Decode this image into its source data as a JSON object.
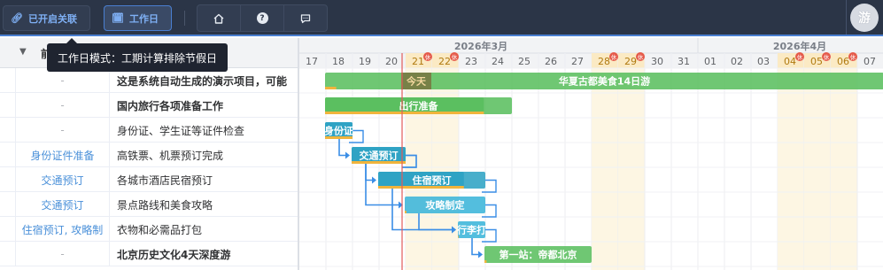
{
  "toolbar": {
    "linked_label": "已开启关联",
    "link_icon": "link-icon",
    "workday_label": "工作日",
    "calendar_icon": "calendar-icon",
    "home_icon": "home-icon",
    "help_glyph": "?",
    "comment_icon": "comment-icon",
    "avatar_text": "游"
  },
  "tooltip": {
    "text": "工作日模式：工期计算排除节假日"
  },
  "grid": {
    "header_text": "前",
    "rows": [
      {
        "dep": "-",
        "name": "这是系统自动生成的演示项目，可能",
        "bold": true
      },
      {
        "dep": "-",
        "name": "国内旅行各项准备工作",
        "bold": true
      },
      {
        "dep": "-",
        "name": "身份证、学生证等证件检查",
        "bold": false
      },
      {
        "dep": "身份证件准备",
        "name": "高铁票、机票预订完成",
        "bold": false
      },
      {
        "dep": "交通预订",
        "name": "各城市酒店民宿预订",
        "bold": false
      },
      {
        "dep": "交通预订",
        "name": "景点路线和美食攻略",
        "bold": false
      },
      {
        "dep": "住宿预订, 攻略制",
        "name": "衣物和必需品打包",
        "bold": false
      },
      {
        "dep": "-",
        "name": "北京历史文化4天深度游",
        "bold": true
      }
    ]
  },
  "timeline": {
    "months": [
      {
        "label": "2026年3月",
        "day_index": 7
      },
      {
        "label": "2026年4月",
        "day_index": 19
      }
    ],
    "days": [
      {
        "d": "17",
        "hl": false,
        "holiday": false
      },
      {
        "d": "18",
        "hl": false,
        "holiday": false
      },
      {
        "d": "19",
        "hl": false,
        "holiday": false
      },
      {
        "d": "20",
        "hl": false,
        "holiday": false
      },
      {
        "d": "21",
        "hl": true,
        "holiday": true
      },
      {
        "d": "22",
        "hl": true,
        "holiday": true
      },
      {
        "d": "23",
        "hl": false,
        "holiday": false
      },
      {
        "d": "24",
        "hl": false,
        "holiday": false
      },
      {
        "d": "25",
        "hl": false,
        "holiday": false
      },
      {
        "d": "26",
        "hl": false,
        "holiday": false
      },
      {
        "d": "27",
        "hl": false,
        "holiday": false
      },
      {
        "d": "28",
        "hl": true,
        "holiday": true
      },
      {
        "d": "29",
        "hl": true,
        "holiday": true
      },
      {
        "d": "30",
        "hl": false,
        "holiday": false
      },
      {
        "d": "31",
        "hl": false,
        "holiday": false
      },
      {
        "d": "01",
        "hl": false,
        "holiday": false
      },
      {
        "d": "02",
        "hl": false,
        "holiday": false
      },
      {
        "d": "03",
        "hl": false,
        "holiday": false
      },
      {
        "d": "04",
        "hl": true,
        "holiday": true
      },
      {
        "d": "05",
        "hl": true,
        "holiday": true
      },
      {
        "d": "06",
        "hl": true,
        "holiday": true
      },
      {
        "d": "07",
        "hl": false,
        "holiday": false
      }
    ],
    "holiday_mark": "休",
    "today_label": "今天",
    "today_index": 4,
    "bars": [
      {
        "row": 0,
        "start": 0,
        "end": 21,
        "label": "华夏古都美食14日游",
        "color": "#5bbf60",
        "text_color": "#ffffff",
        "progress": 0
      },
      {
        "row": 1,
        "start": 0,
        "end": 7,
        "label": "出行准备",
        "color": "#5bbf60",
        "text_color": "#ffffff",
        "progress": 0.85
      },
      {
        "row": 2,
        "start": 0,
        "end": 1,
        "label": "身份证",
        "color": "#2fa3c4",
        "text_color": "#ffffff",
        "progress": 1
      },
      {
        "row": 3,
        "start": 1,
        "end": 3,
        "label": "交通预订",
        "color": "#2fa3c4",
        "text_color": "#ffffff",
        "progress": 1
      },
      {
        "row": 4,
        "start": 2,
        "end": 6,
        "label": "住宿预订",
        "color": "#2fa3c4",
        "text_color": "#ffffff",
        "progress": 0.8
      },
      {
        "row": 5,
        "start": 3,
        "end": 6,
        "label": "攻略制定",
        "color": "#3bb5d9",
        "text_color": "#ffffff",
        "progress": 0
      },
      {
        "row": 6,
        "start": 5,
        "end": 6,
        "label": "行李打",
        "color": "#3bb5d9",
        "text_color": "#ffffff",
        "progress": 0
      },
      {
        "row": 7,
        "start": 6,
        "end": 10,
        "label": "第一站：帝都北京",
        "color": "#5bbf60",
        "text_color": "#ffffff",
        "progress": 0
      }
    ],
    "links": [
      {
        "from": 2,
        "to": 3
      },
      {
        "from": 3,
        "to": 4
      },
      {
        "from": 3,
        "to": 5
      },
      {
        "from": 4,
        "to": 6
      },
      {
        "from": 5,
        "to": 6
      },
      {
        "from": 6,
        "to": 7
      }
    ]
  },
  "colors": {
    "toolbar_bg": "#2b3547",
    "accent": "#4a7fd1",
    "holiday_bg": "#fdf6e3",
    "today_line": "#e25b5b",
    "bar_green": "#5bbf60",
    "bar_blue": "#2fa3c4",
    "link": "#3a8ee6"
  }
}
